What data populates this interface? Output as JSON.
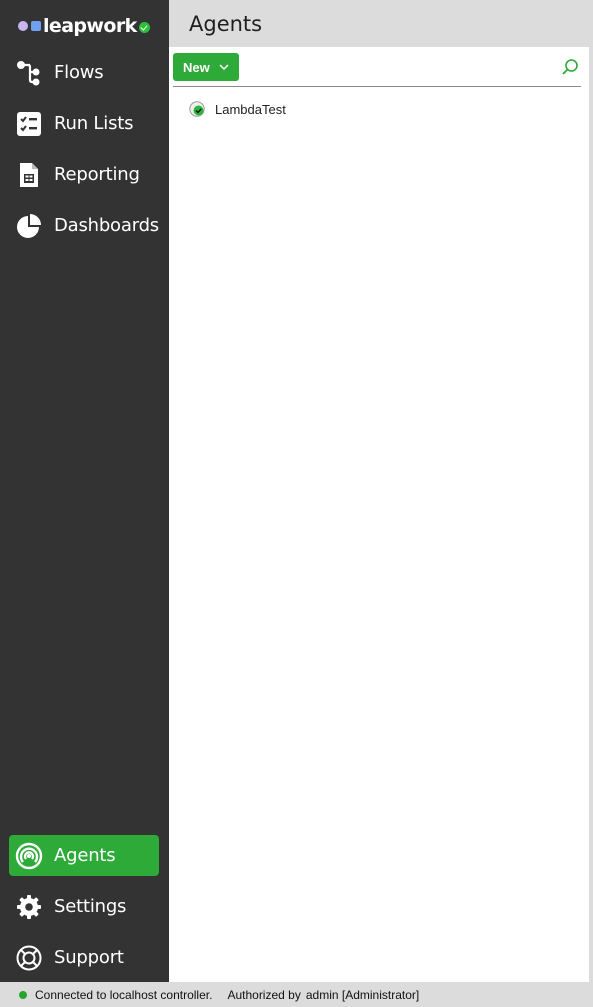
{
  "app": {
    "logo_text": "leapwork"
  },
  "sidebar": {
    "items": [
      {
        "label": "Flows",
        "icon": "flows-icon"
      },
      {
        "label": "Run Lists",
        "icon": "run-lists-icon"
      },
      {
        "label": "Reporting",
        "icon": "reporting-icon"
      },
      {
        "label": "Dashboards",
        "icon": "dashboards-icon"
      }
    ],
    "bottom_items": [
      {
        "label": "Agents",
        "icon": "agents-icon",
        "active": true
      },
      {
        "label": "Settings",
        "icon": "gear-icon"
      },
      {
        "label": "Support",
        "icon": "lifebuoy-icon"
      }
    ]
  },
  "main": {
    "title": "Agents",
    "toolbar": {
      "new_label": "New"
    },
    "agents": [
      {
        "name": "LambdaTest",
        "status": "connected"
      }
    ]
  },
  "statusbar": {
    "connection": "Connected to localhost controller.",
    "auth_label": "Authorized by",
    "user": "admin [Administrator]"
  },
  "colors": {
    "sidebar_bg": "#333333",
    "accent_green": "#2eaa39",
    "header_bg": "#dcdcdc"
  }
}
